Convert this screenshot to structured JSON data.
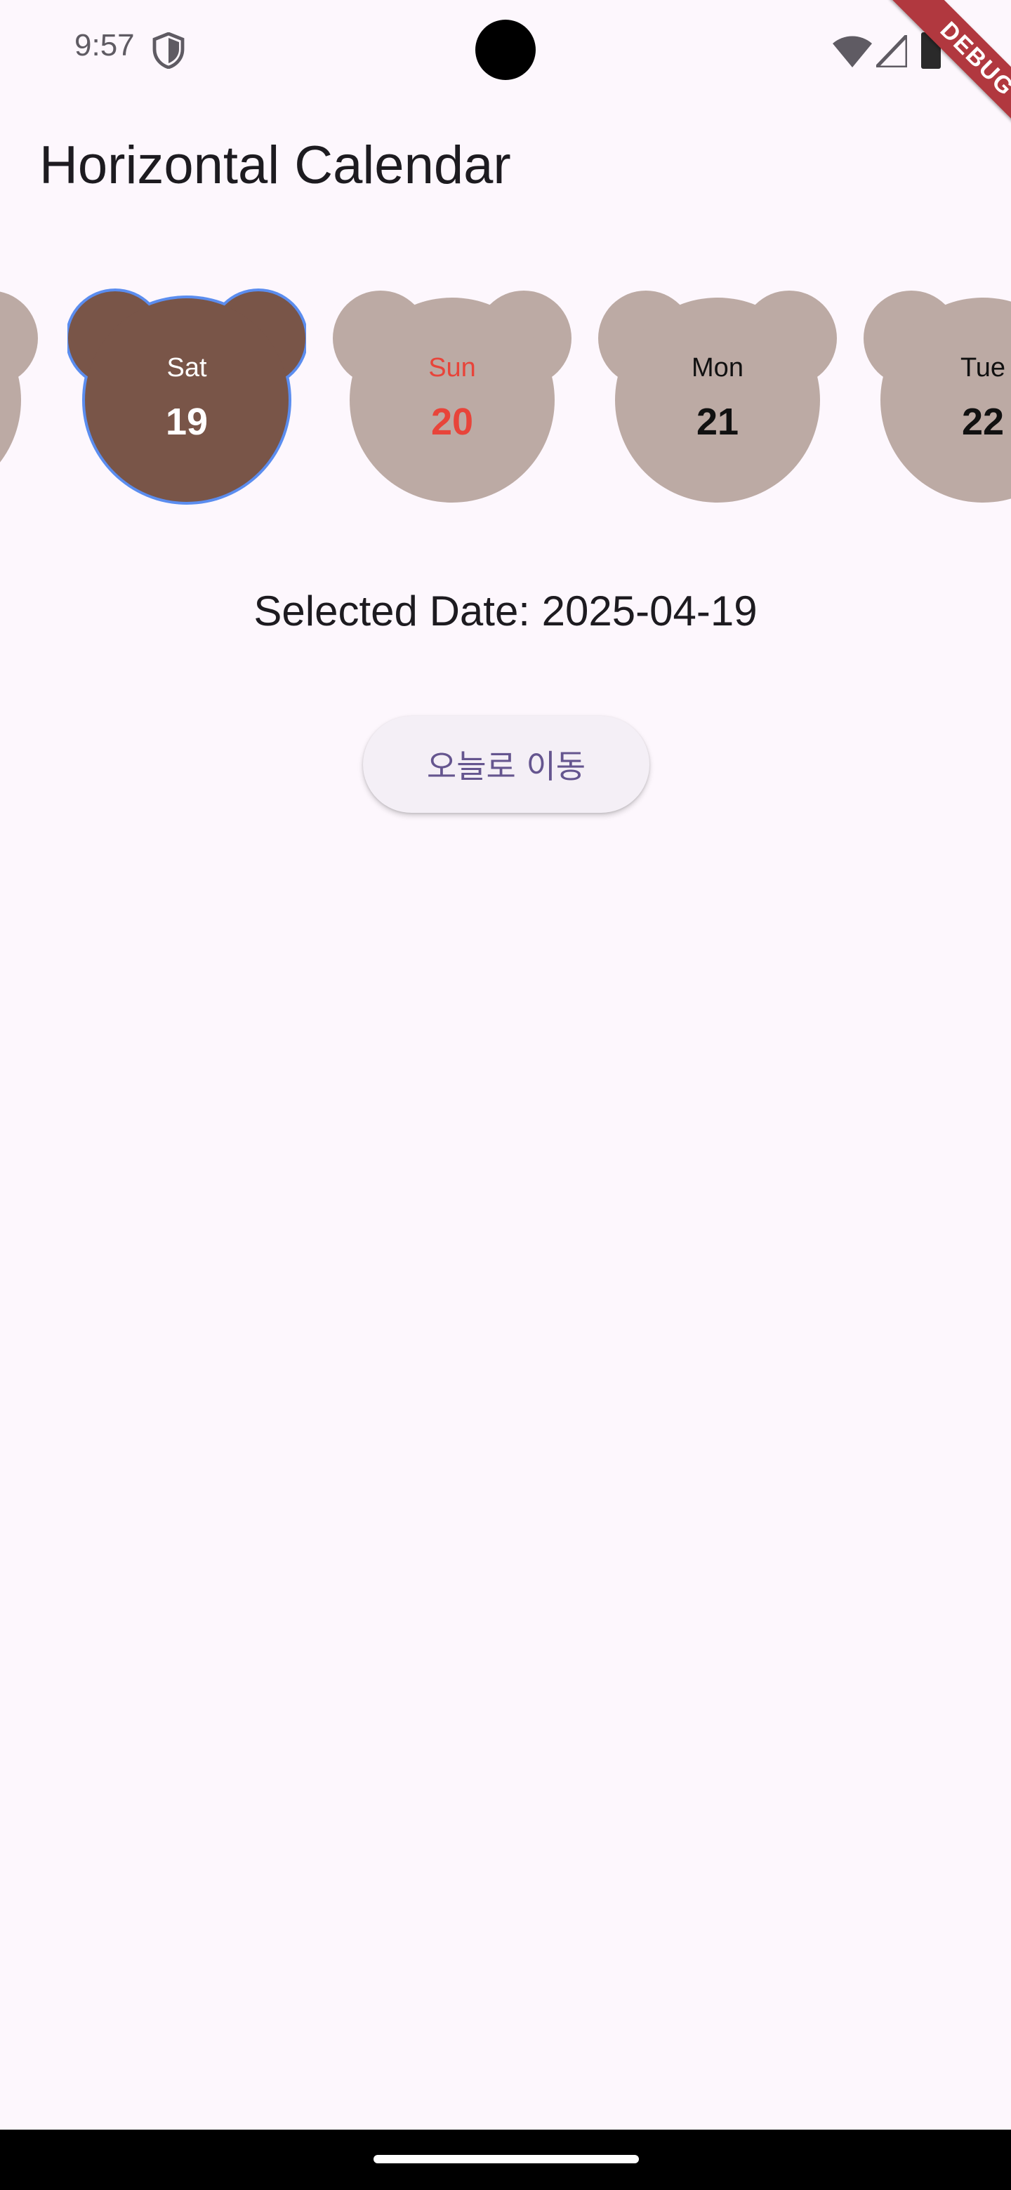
{
  "status_bar": {
    "time": "9:57"
  },
  "debug_banner": "DEBUG",
  "app_title": "Horizontal Calendar",
  "calendar": {
    "days": [
      {
        "name": "",
        "number": ""
      },
      {
        "name": "Sat",
        "number": "19"
      },
      {
        "name": "Sun",
        "number": "20"
      },
      {
        "name": "Mon",
        "number": "21"
      },
      {
        "name": "Tue",
        "number": "22"
      }
    ]
  },
  "colors": {
    "selected_fill": "#795548",
    "selected_border": "#5b8def",
    "day_fill": "#bcaaa4",
    "sunday_text": "#e8443a",
    "background": "#fdf7fd",
    "button_text": "#65558f"
  },
  "selected_date_text": "Selected Date: 2025-04-19",
  "today_button_label": "오늘로 이동"
}
